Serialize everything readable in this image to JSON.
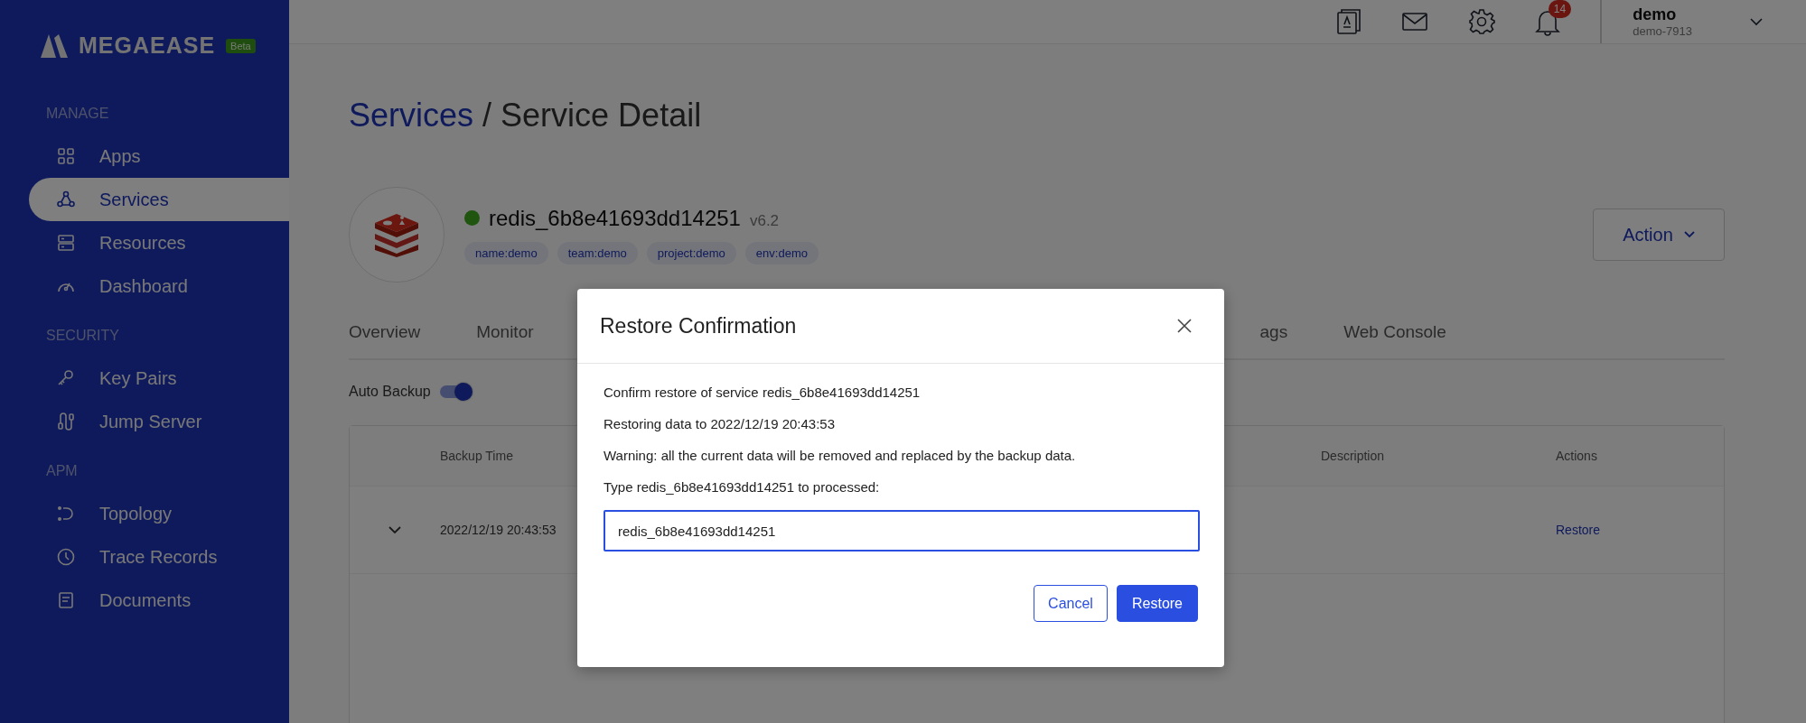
{
  "sidebar": {
    "logo": {
      "text": "MEGAEASE",
      "badge": "Beta"
    },
    "sections": [
      {
        "title": "MANAGE",
        "items": [
          {
            "label": "Apps",
            "selected": false
          },
          {
            "label": "Services",
            "selected": true
          },
          {
            "label": "Resources",
            "selected": false
          },
          {
            "label": "Dashboard",
            "selected": false
          }
        ]
      },
      {
        "title": "SECURITY",
        "items": [
          {
            "label": "Key Pairs",
            "selected": false
          },
          {
            "label": "Jump Server",
            "selected": false
          }
        ]
      },
      {
        "title": "APM",
        "items": [
          {
            "label": "Topology",
            "selected": false
          },
          {
            "label": "Trace Records",
            "selected": false
          },
          {
            "label": "Documents",
            "selected": false
          }
        ]
      }
    ]
  },
  "header": {
    "notification_count": "14",
    "user": {
      "name": "demo",
      "account": "demo-7913"
    }
  },
  "breadcrumb": {
    "parent": "Services",
    "separator": "/",
    "current": "Service Detail"
  },
  "service": {
    "name": "redis_6b8e41693dd14251",
    "version": "v6.2",
    "online": true,
    "tags": [
      "name:demo",
      "team:demo",
      "project:demo",
      "env:demo"
    ],
    "action_button": "Action"
  },
  "tabs": [
    {
      "label": "Overview",
      "selected": false
    },
    {
      "label": "Monitor",
      "selected": false
    },
    {
      "label": "ags",
      "selected": false
    },
    {
      "label": "Web Console",
      "selected": false
    }
  ],
  "auto_backup": {
    "label": "Auto Backup",
    "on": true
  },
  "table": {
    "columns": [
      "Backup Time",
      "Description",
      "Actions"
    ],
    "rows": [
      {
        "backup_time": "2022/12/19 20:43:53",
        "action": "Restore",
        "expanded": false
      }
    ]
  },
  "dialog": {
    "title": "Restore Confirmation",
    "lines": [
      "Confirm restore of service redis_6b8e41693dd14251",
      "Restoring data to 2022/12/19 20:43:53",
      "Warning: all the current data will be removed and replaced by the backup data.",
      "Type redis_6b8e41693dd14251 to processed:"
    ],
    "input_value": "redis_6b8e41693dd14251",
    "cancel": "Cancel",
    "confirm": "Restore"
  }
}
